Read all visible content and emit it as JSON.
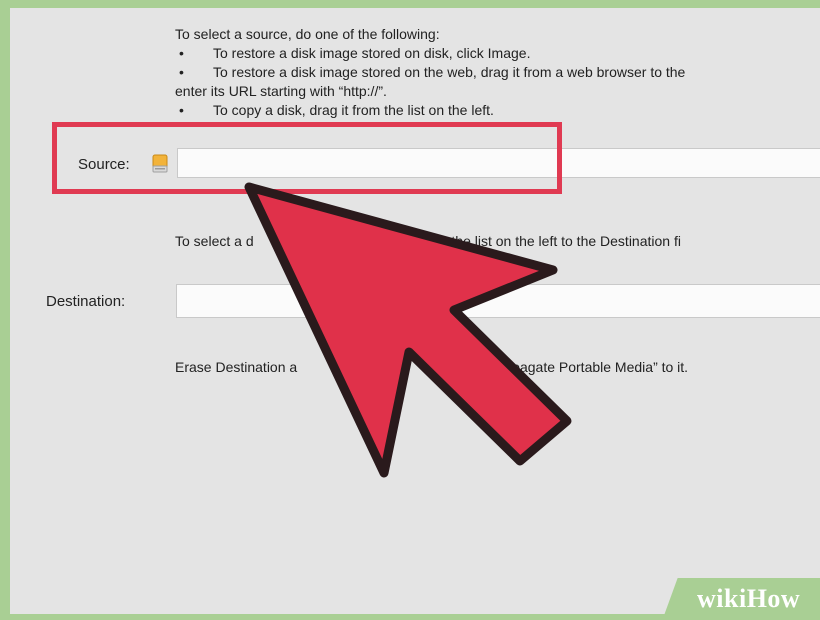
{
  "instructions": {
    "heading": "To select a source, do one of the following:",
    "bullet": "•",
    "items": [
      "To restore a disk image stored on disk, click Image.",
      "To restore a disk image stored on the web, drag it from a web browser to the",
      "To copy a disk, drag it from the list on the left."
    ],
    "continuation": "enter its URL starting with “http://”."
  },
  "source": {
    "label": "Source:",
    "value": "",
    "icon": "external-disk-icon"
  },
  "destination": {
    "instruction_left": "To select a d",
    "instruction_right": "it from the list on the left to the Destination fi",
    "label": "Destination:",
    "value": ""
  },
  "erase": {
    "text_left": "Erase Destination a",
    "text_right": "“Seagate Portable Media” to it."
  },
  "annotation": {
    "highlight_color": "#e03a52",
    "arrow_color": "#e0314a",
    "arrow_icon": "pointer-arrow-icon"
  },
  "watermark": {
    "wiki": "wiki",
    "how": "How"
  }
}
